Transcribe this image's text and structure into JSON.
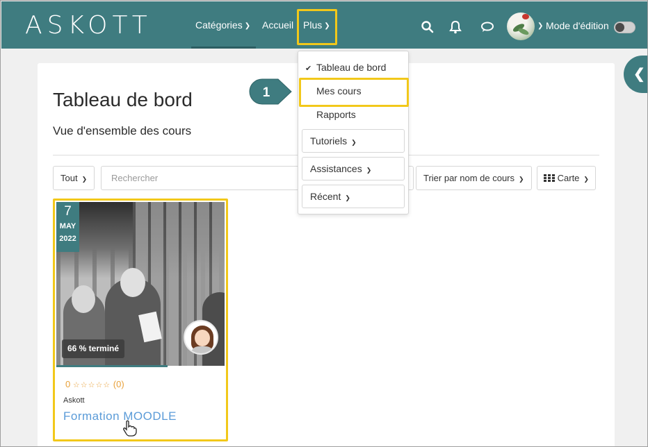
{
  "navbar": {
    "logo": "ASKOTT",
    "categories_label": "Catégories",
    "home_label": "Accueil",
    "more_label": "Plus",
    "edit_mode_label": "Mode d'édition"
  },
  "more_menu": {
    "dashboard_label": "Tableau de bord",
    "my_courses_label": "Mes cours",
    "reports_label": "Rapports",
    "tutorials_label": "Tutoriels",
    "assistance_label": "Assistances",
    "recent_label": "Récent"
  },
  "page": {
    "title": "Tableau de bord",
    "subtitle": "Vue d'ensemble des cours"
  },
  "filters": {
    "filter_value": "Tout",
    "search_placeholder": "Rechercher",
    "sort_value": "Trier par nom de cours",
    "view_value": "Carte"
  },
  "course": {
    "date_day": "7",
    "date_month": "MAY",
    "date_year": "2022",
    "progress_label": "66 % terminé",
    "progress": 66,
    "rating_value": "0",
    "rating_stars": "☆☆☆☆☆",
    "rating_count": "(0)",
    "category": "Askott",
    "name": "Formation MOODLE"
  },
  "callout": {
    "step": "1"
  },
  "colors": {
    "brand": "#3f7c80",
    "highlight": "#f2c81a",
    "link": "#5a9bd8",
    "rating": "#e8a13a"
  }
}
